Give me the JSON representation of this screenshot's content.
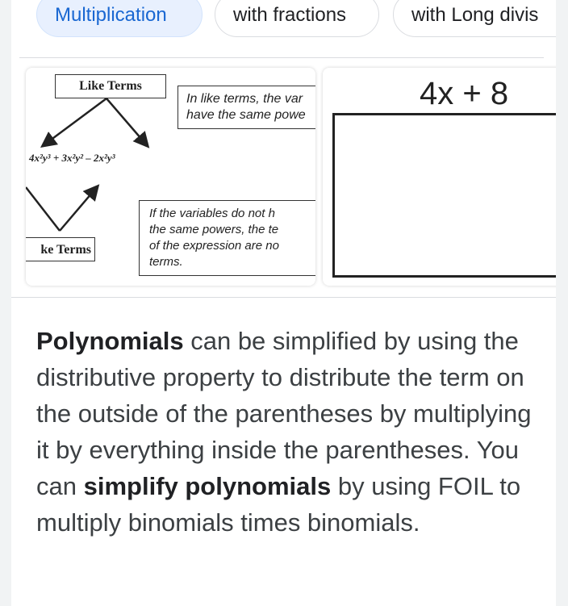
{
  "chips": [
    {
      "label": "Multiplication",
      "active": true
    },
    {
      "label": "with fractions",
      "active": false
    },
    {
      "label": "with Long divis",
      "active": false
    }
  ],
  "image1": {
    "like_terms_label": "Like Terms",
    "unlike_terms_label": "ke Terms",
    "note1_line1": "In like terms, the var",
    "note1_line2": "have the same powe",
    "expression": "4x²y³ + 3x²y² – 2x²y³",
    "note2_line1": "If the variables do not h",
    "note2_line2": "the same powers, the te",
    "note2_line3": "of the expression are no",
    "note2_line4": "terms."
  },
  "image2": {
    "expression": "4x + 8"
  },
  "paragraph": {
    "p1_bold": "Polynomials",
    "p2": " can be simplified by using the distributive property to distribute the term on the outside of the parentheses by multiplying it by everything inside the parentheses. You can ",
    "p3_bold": "simplify polynomials",
    "p4": " by using FOIL to multiply binomials times binomials."
  },
  "colors": {
    "active_chip_bg": "#e8f0fe",
    "active_chip_text": "#1967d2"
  }
}
